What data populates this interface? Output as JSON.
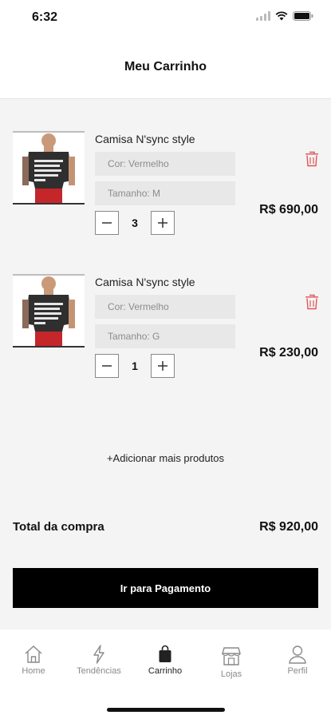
{
  "status_bar": {
    "time": "6:32"
  },
  "header": {
    "title": "Meu Carrinho"
  },
  "cart": {
    "items": [
      {
        "name": "Camisa N'sync style",
        "color": "Cor: Vermelho",
        "size": "Tamanho: M",
        "quantity": "3",
        "price": "R$ 690,00"
      },
      {
        "name": "Camisa N'sync style",
        "color": "Cor: Vermelho",
        "size": "Tamanho: G",
        "quantity": "1",
        "price": "R$ 230,00"
      }
    ],
    "add_more_label": "+Adicionar mais produtos",
    "total_label": "Total da compra",
    "total_value": "R$ 920,00",
    "pay_button_label": "Ir para Pagamento"
  },
  "tabbar": {
    "tabs": [
      {
        "label": "Home",
        "icon": "home-icon"
      },
      {
        "label": "Tendências",
        "icon": "lightning-icon"
      },
      {
        "label": "Carrinho",
        "icon": "shopping-bag-icon",
        "active": true
      },
      {
        "label": "Lojas",
        "icon": "store-icon"
      },
      {
        "label": "Perfil",
        "icon": "user-icon"
      }
    ]
  },
  "colors": {
    "accent": "#000000",
    "delete": "#e05555",
    "background": "#f4f4f4"
  }
}
